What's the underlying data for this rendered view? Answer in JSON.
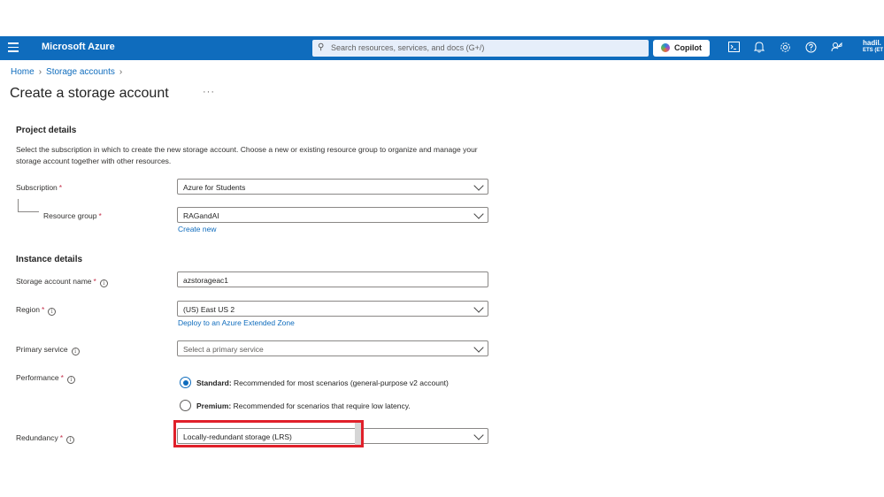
{
  "topbar": {
    "brand": "Microsoft Azure",
    "search_placeholder": "Search resources, services, and docs (G+/)",
    "copilot_label": "Copilot",
    "user_name": "hadil.",
    "user_tenant": "ETS (ET"
  },
  "breadcrumb": {
    "items": [
      "Home",
      "Storage accounts"
    ]
  },
  "page": {
    "title": "Create a storage account",
    "more": "···"
  },
  "project_details": {
    "title": "Project details",
    "description": "Select the subscription in which to create the new storage account. Choose a new or existing resource group to organize and manage your storage account together with other resources.",
    "subscription_label": "Subscription",
    "subscription_value": "Azure for Students",
    "resource_group_label": "Resource group",
    "resource_group_value": "RAGandAI",
    "create_new_link": "Create new"
  },
  "instance_details": {
    "title": "Instance details",
    "name_label": "Storage account name",
    "name_value": "azstorageac1",
    "region_label": "Region",
    "region_value": "(US) East US 2",
    "extended_zone_link": "Deploy to an Azure Extended Zone",
    "primary_service_label": "Primary service",
    "primary_service_placeholder": "Select a primary service",
    "performance_label": "Performance",
    "performance_options": [
      {
        "name": "Standard:",
        "desc": " Recommended for most scenarios (general-purpose v2 account)",
        "checked": true
      },
      {
        "name": "Premium:",
        "desc": " Recommended for scenarios that require low latency.",
        "checked": false
      }
    ],
    "redundancy_label": "Redundancy",
    "redundancy_value": "Locally-redundant storage (LRS)"
  },
  "markers": {
    "required": "*",
    "info": "i"
  },
  "colors": {
    "topbar": "#0f6cbd",
    "link": "#0f6cbd",
    "highlight": "#e0202a",
    "required": "#c4314b"
  }
}
